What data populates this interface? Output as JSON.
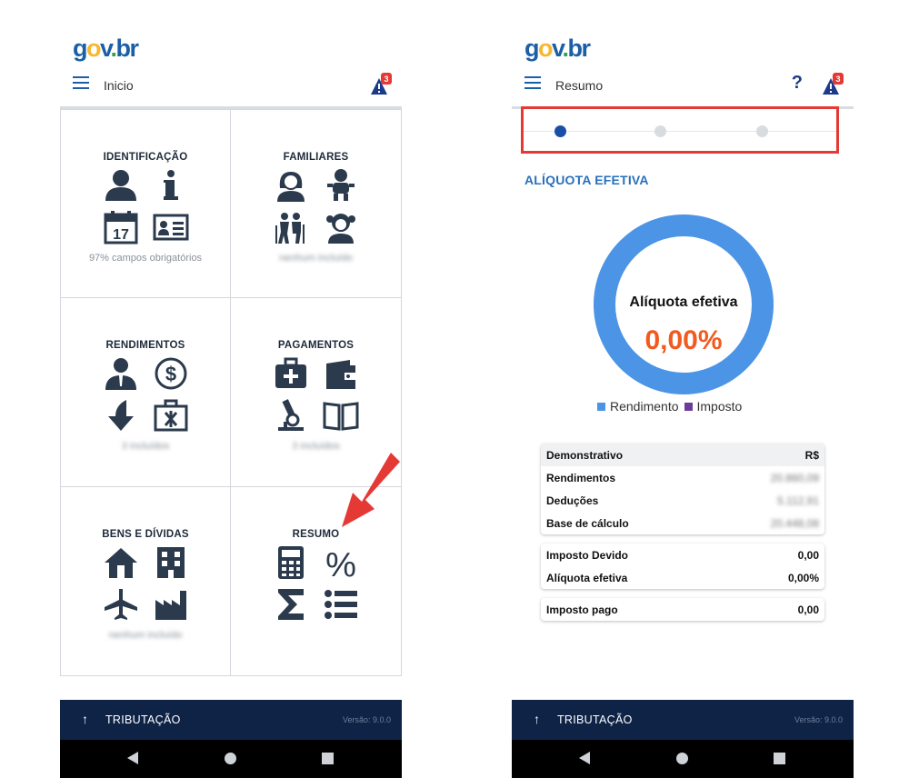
{
  "left": {
    "logo": {
      "g": "g",
      "o": "o",
      "v": "v",
      "dot": ".",
      "br": "br"
    },
    "header": {
      "title": "Inicio",
      "alert_count": "3"
    },
    "tiles": [
      {
        "title": "IDENTIFICAÇÃO",
        "subtitle": "97% campos obrigatórios",
        "icons": [
          "person-icon",
          "info-icon",
          "calendar-icon",
          "id-card-icon"
        ]
      },
      {
        "title": "FAMILIARES",
        "subtitle": "nenhum incluído",
        "icons": [
          "woman-icon",
          "baby-icon",
          "elderly-couple-icon",
          "girl-icon"
        ]
      },
      {
        "title": "RENDIMENTOS",
        "subtitle": "3 incluídos",
        "icons": [
          "employee-icon",
          "dollar-coin-icon",
          "arrow-down-icon",
          "briefcase-icon"
        ]
      },
      {
        "title": "PAGAMENTOS",
        "subtitle": "3 incluídos",
        "icons": [
          "medical-kit-icon",
          "wallet-icon",
          "microscope-icon",
          "book-icon"
        ]
      },
      {
        "title": "BENS E DÍVIDAS",
        "subtitle": "nenhum incluído",
        "icons": [
          "house-icon",
          "building-icon",
          "airplane-icon",
          "factory-icon"
        ]
      },
      {
        "title": "RESUMO",
        "subtitle": "",
        "icons": [
          "calculator-icon",
          "percent-icon",
          "sigma-icon",
          "list-icon"
        ]
      }
    ],
    "bottom_bar": {
      "arrow": "↑",
      "label": "TRIBUTAÇÃO",
      "version": "Versão: 9.0.0"
    }
  },
  "right": {
    "logo": {
      "g": "g",
      "o": "o",
      "v": "v",
      "dot": ".",
      "br": "br"
    },
    "header": {
      "title": "Resumo",
      "help": "?",
      "alert_count": "3"
    },
    "steps": [
      {
        "active": true
      },
      {
        "active": false
      },
      {
        "active": false
      }
    ],
    "section_title": "ALÍQUOTA EFETIVA",
    "donut": {
      "label": "Alíquota efetiva",
      "value": "0,00%",
      "rendimento_share": 1.0,
      "imposto_share": 0.0
    },
    "legend": [
      {
        "label": "Rendimento",
        "color": "#4b94e6"
      },
      {
        "label": "Imposto",
        "color": "#6a3d9a"
      }
    ],
    "summary_card": {
      "header": {
        "label": "Demonstrativo",
        "value": "R$"
      },
      "rows": [
        {
          "label": "Rendimentos",
          "value": "20.860,09"
        },
        {
          "label": "Deduções",
          "value": "5.112,91"
        },
        {
          "label": "Base de cálculo",
          "value": "20.448,08"
        }
      ]
    },
    "tax_card": {
      "rows": [
        {
          "label": "Imposto Devido",
          "value": "0,00"
        },
        {
          "label": "Alíquota efetiva",
          "value": "0,00%"
        }
      ]
    },
    "paid_card": {
      "rows": [
        {
          "label": "Imposto pago",
          "value": "0,00"
        }
      ]
    },
    "bottom_bar": {
      "arrow": "↑",
      "label": "TRIBUTAÇÃO",
      "version": "Versão: 9.0.0"
    }
  },
  "colors": {
    "accent": "#1b5fa7",
    "navy": "#0f2347",
    "highlight": "#e53935",
    "value_orange": "#f25a1f"
  }
}
